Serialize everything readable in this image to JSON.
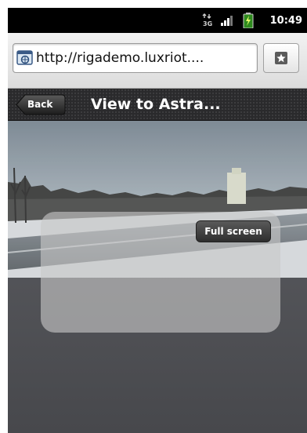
{
  "status_bar": {
    "time": "10:49",
    "network_icon": "3g-data-icon",
    "signal_icon": "signal-icon",
    "battery_icon": "battery-charging-icon"
  },
  "browser": {
    "url": "http://rigademo.luxriot....",
    "page_icon": "webpage-icon",
    "bookmark_icon": "bookmark-star-icon"
  },
  "header": {
    "back_label": "Back",
    "title": "View to Astra..."
  },
  "player": {
    "fullscreen_label": "Full screen"
  }
}
